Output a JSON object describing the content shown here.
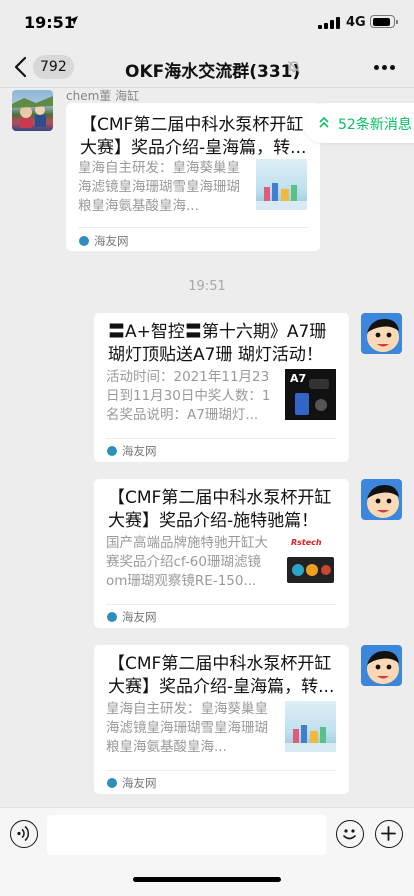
{
  "status_bar": {
    "time": "19:51",
    "network": "4G"
  },
  "nav": {
    "unread_count": "792",
    "title": "OKF海水交流群(331)"
  },
  "new_messages": {
    "label": "52条新消息"
  },
  "messages": [
    {
      "sender": "chem董 海缸",
      "title": "【CMF第二届中科水泵杯开缸大赛】奖品介绍-皇海篇，转...",
      "description": "皇海自主研发：皇海葵巢皇海滤镜皇海珊瑚雪皇海珊瑚粮皇海氨基酸皇海...",
      "source": "海友网"
    },
    {
      "title": "〓A+智控〓第十六期》A7珊瑚灯顶贴送A7珊 瑚灯活动！",
      "description": "活动时间：2021年11月23日到11月30日中奖人数：1名奖品说明：A7珊瑚灯...",
      "thumb_text": "A7",
      "source": "海友网"
    },
    {
      "title": "【CMF第二届中科水泵杯开缸大赛】奖品介绍-施特驰篇！",
      "description": "国产高端品牌施特驰开缸大赛奖品介绍cf-60珊瑚滤镜om珊瑚观察镜RE-150...",
      "thumb_text": "Rstech",
      "source": "海友网"
    },
    {
      "title": "【CMF第二届中科水泵杯开缸大赛】奖品介绍-皇海篇，转...",
      "description": "皇海自主研发：皇海葵巢皇海滤镜皇海珊瑚雪皇海珊瑚粮皇海氨基酸皇海...",
      "source": "海友网"
    }
  ],
  "time_divider": "19:51",
  "colors": {
    "accent_green": "#07c160",
    "chat_bg": "#ededed",
    "card_bg": "#ffffff"
  },
  "icons": [
    "location-arrow-icon",
    "signal-icon",
    "battery-icon",
    "back-chevron-icon",
    "mute-bell-icon",
    "more-dots-icon",
    "double-chevron-up-icon",
    "voice-icon",
    "emoji-icon",
    "plus-icon"
  ]
}
